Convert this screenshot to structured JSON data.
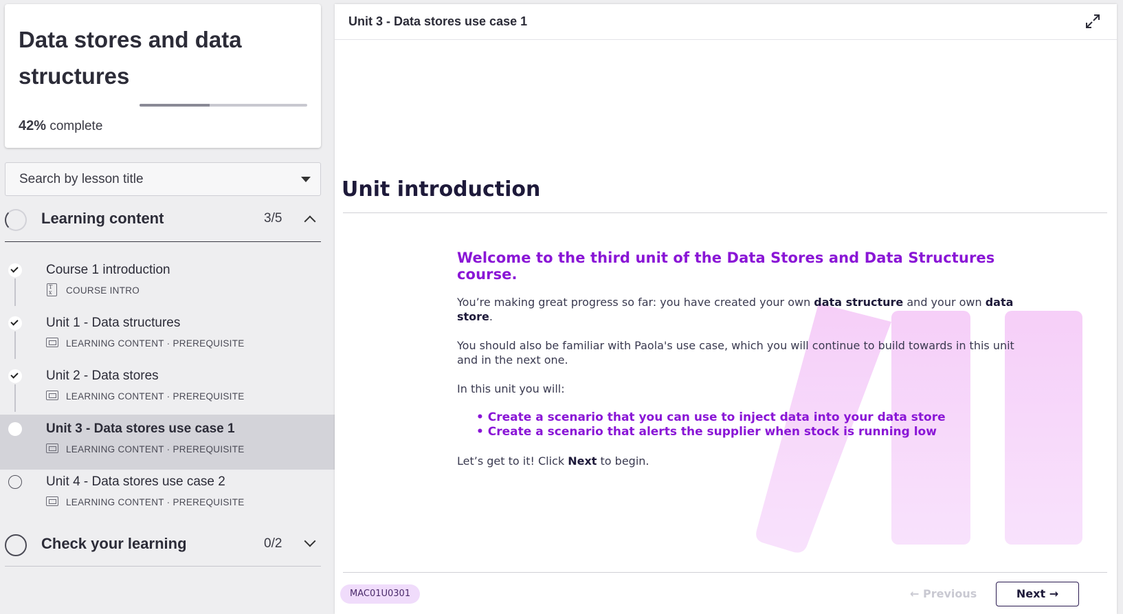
{
  "course": {
    "title": "Data stores and data structures",
    "progress_percent": 42,
    "progress_pct_label": "42%",
    "progress_suffix": "complete"
  },
  "search": {
    "placeholder": "Search by lesson title"
  },
  "sections": [
    {
      "label": "Learning content",
      "count": "3/5",
      "expanded": true,
      "lessons": [
        {
          "title": "Course 1 introduction",
          "meta": "COURSE INTRO",
          "status": "complete",
          "icon": "document-icon"
        },
        {
          "title": "Unit 1 - Data structures",
          "meta": "LEARNING CONTENT · PREREQUISITE",
          "status": "complete",
          "icon": "slides-icon"
        },
        {
          "title": "Unit 2 - Data stores",
          "meta": "LEARNING CONTENT · PREREQUISITE",
          "status": "complete",
          "icon": "slides-icon"
        },
        {
          "title": "Unit 3 - Data stores use case 1",
          "meta": "LEARNING CONTENT · PREREQUISITE",
          "status": "current",
          "icon": "slides-icon"
        },
        {
          "title": "Unit 4 - Data stores use case 2",
          "meta": "LEARNING CONTENT · PREREQUISITE",
          "status": "not-started",
          "icon": "slides-icon"
        }
      ]
    },
    {
      "label": "Check your learning",
      "count": "0/2",
      "expanded": false
    }
  ],
  "main": {
    "header_title": "Unit 3 - Data stores use case 1",
    "heading": "Unit introduction",
    "welcome": "Welcome to the third unit of the Data Stores and Data Structures course.",
    "p1_a": "You’re making great progress so far: you have created your own ",
    "p1_b": "data structure",
    "p1_c": " and your own ",
    "p1_d": "data store",
    "p1_e": ".",
    "p2": "You should also be familiar with Paola's use case, which you will continue to build towards in this unit and in the next one.",
    "p3": "In this unit you will:",
    "bullets": [
      "Create a scenario that you can use to inject data into your data store",
      "Create a scenario that alerts the supplier when stock is running low"
    ],
    "p4_a": "Let’s get to it! Click ",
    "p4_b": "Next",
    "p4_c": " to begin.",
    "code": "MAC01U0301",
    "previous_label": "← Previous",
    "next_label": "Next →"
  },
  "colors": {
    "accent_purple": "#8a16d6",
    "heading_navy": "#1e1a3a",
    "code_badge_bg": "#f0dcfb"
  }
}
